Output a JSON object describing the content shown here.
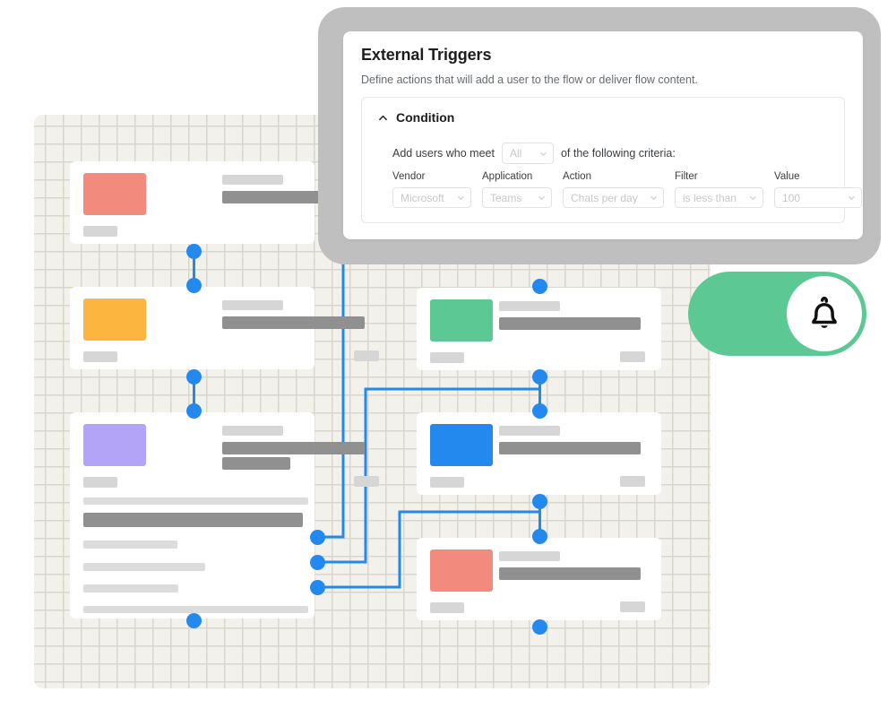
{
  "panel": {
    "title": "External Triggers",
    "subtitle": "Define actions that will add a user to the flow or deliver flow content.",
    "condition": {
      "collapse_icon": "chevron-up-icon",
      "title": "Condition",
      "sentence_prefix": "Add users who meet",
      "sentence_suffix": "of the following criteria:",
      "match_select": {
        "value": "All",
        "icon": "chevron-down-icon"
      },
      "fields": [
        {
          "label": "Vendor",
          "value": "Microsoft",
          "icon": "chevron-down-icon"
        },
        {
          "label": "Application",
          "value": "Teams",
          "icon": "chevron-down-icon"
        },
        {
          "label": "Action",
          "value": "Chats per day",
          "icon": "chevron-down-icon"
        },
        {
          "label": "Filter",
          "value": "is less than",
          "icon": "chevron-down-icon"
        },
        {
          "label": "Value",
          "value": "100",
          "icon": "chevron-down-icon"
        }
      ]
    }
  },
  "notification_toggle": {
    "state": "on",
    "icon": "bell-icon",
    "track_color": "#5cc894",
    "knob_color": "#ffffff"
  },
  "flow": {
    "canvas_color": "#f2f1ec",
    "node_color": "#2489ef",
    "cards": [
      {
        "name": "flow-card-coral-top",
        "swatch_color": "#f28b7d",
        "column": "left",
        "rows": 2
      },
      {
        "name": "flow-card-amber",
        "swatch_color": "#fcb63f",
        "column": "left",
        "rows": 2
      },
      {
        "name": "flow-card-violet",
        "swatch_color": "#b3a4f7",
        "column": "left",
        "rows": 7
      },
      {
        "name": "flow-card-green",
        "swatch_color": "#5cc894",
        "column": "right",
        "rows": 2
      },
      {
        "name": "flow-card-blue",
        "swatch_color": "#2489ef",
        "column": "right",
        "rows": 2
      },
      {
        "name": "flow-card-coral-bottom",
        "swatch_color": "#f28b7d",
        "column": "right",
        "rows": 2
      }
    ]
  },
  "backdrop": {
    "color": "#bfbfbf"
  }
}
